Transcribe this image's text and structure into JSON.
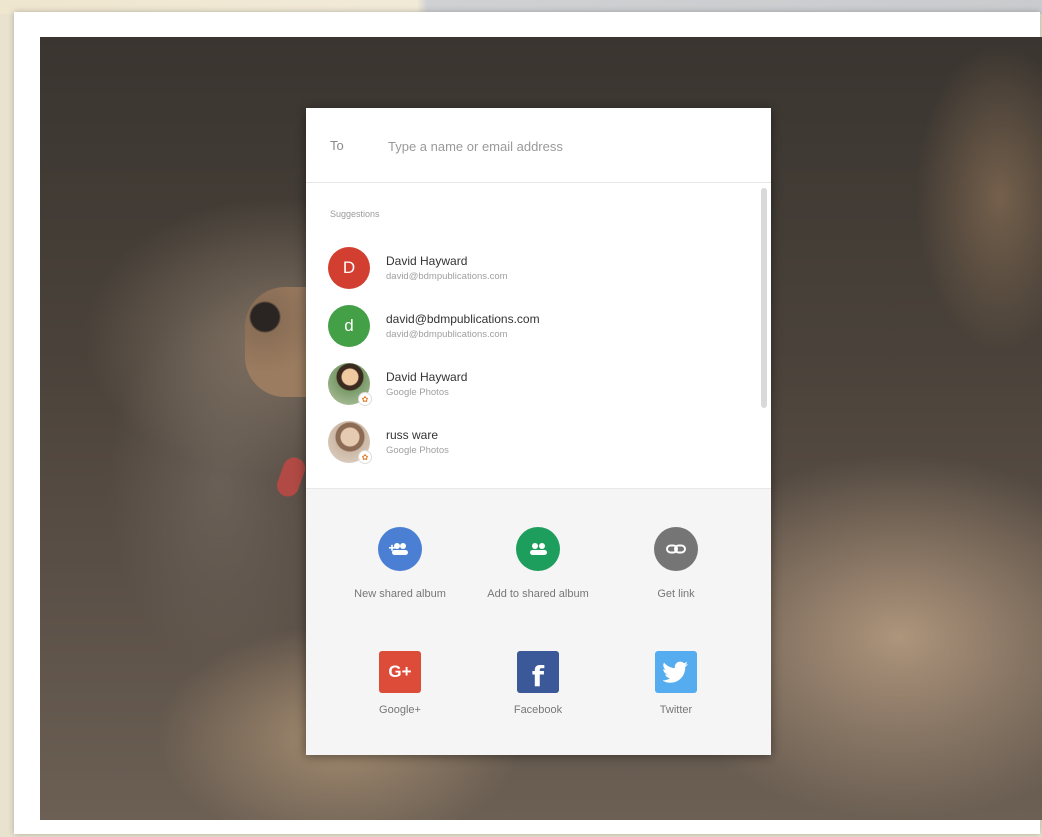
{
  "share_dialog": {
    "to_label": "To",
    "to_placeholder": "Type a name or email address",
    "suggestions_heading": "Suggestions",
    "suggestions": [
      {
        "name": "David Hayward",
        "detail": "david@bdmpublications.com",
        "avatar_letter": "D",
        "avatar_color": "#d23f31"
      },
      {
        "name": "david@bdmpublications.com",
        "detail": "david@bdmpublications.com",
        "avatar_letter": "d",
        "avatar_color": "#43a047"
      },
      {
        "name": "David Hayward",
        "detail": "Google Photos",
        "avatar_letter": "",
        "avatar_color": ""
      },
      {
        "name": "russ ware",
        "detail": "Google Photos",
        "avatar_letter": "",
        "avatar_color": ""
      }
    ],
    "actions": [
      {
        "label": "New shared album",
        "icon": "new-shared-album-icon",
        "color": "#4a7fd4"
      },
      {
        "label": "Add to shared album",
        "icon": "add-to-shared-album-icon",
        "color": "#1e9e5c"
      },
      {
        "label": "Get link",
        "icon": "link-icon",
        "color": "#757575"
      }
    ],
    "social": [
      {
        "label": "Google+",
        "icon": "google-plus-icon",
        "glyph": "G+",
        "color": "#dd4b39"
      },
      {
        "label": "Facebook",
        "icon": "facebook-icon",
        "glyph": "f",
        "color": "#3b5998"
      },
      {
        "label": "Twitter",
        "icon": "twitter-icon",
        "glyph": "",
        "color": "#55acee"
      }
    ]
  }
}
